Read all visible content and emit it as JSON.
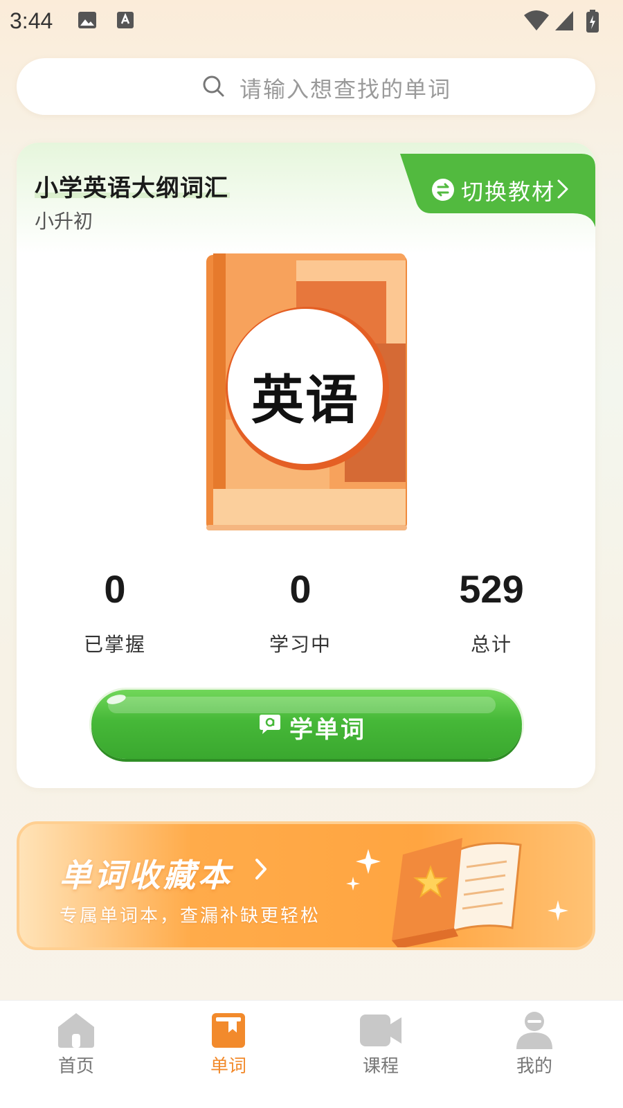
{
  "status_bar": {
    "time": "3:44"
  },
  "search": {
    "placeholder": "请输入想查找的单词"
  },
  "book_card": {
    "title": "小学英语大纲词汇",
    "subtitle": "小升初",
    "switch_label": "切换教材",
    "cover_text": "英语",
    "stats": [
      {
        "value": "0",
        "label": "已掌握",
        "accent": "#d9f2cc"
      },
      {
        "value": "0",
        "label": "学习中",
        "accent": "#fde0cc"
      },
      {
        "value": "529",
        "label": "总计",
        "accent": "#d6e8fb"
      }
    ],
    "learn_button_label": "学单词"
  },
  "favorites": {
    "title": "单词收藏本",
    "subtitle": "专属单词本，查漏补缺更轻松"
  },
  "bottom_nav": {
    "items": [
      {
        "label": "首页",
        "icon": "home-icon",
        "active": false
      },
      {
        "label": "单词",
        "icon": "word-book-icon",
        "active": true
      },
      {
        "label": "课程",
        "icon": "video-camera-icon",
        "active": false
      },
      {
        "label": "我的",
        "icon": "user-icon",
        "active": false
      }
    ]
  },
  "colors": {
    "accent_green": "#4cbc3c",
    "accent_orange": "#f28a2c",
    "inactive_icon": "#c8c8c8"
  }
}
